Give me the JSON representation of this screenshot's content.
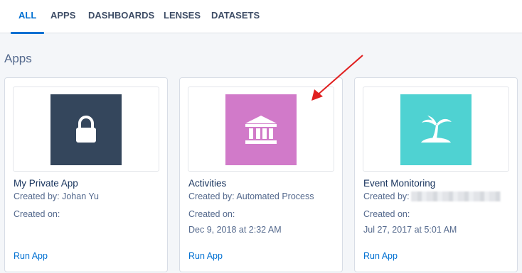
{
  "tabs": [
    {
      "label": "ALL",
      "active": true
    },
    {
      "label": "APPS",
      "active": false
    },
    {
      "label": "DASHBOARDS",
      "active": false
    },
    {
      "label": "LENSES",
      "active": false
    },
    {
      "label": "DATASETS",
      "active": false
    }
  ],
  "section_title": "Apps",
  "cards": [
    {
      "name": "My Private App",
      "created_by": "Created by: Johan Yu",
      "created_on_label": "Created on:",
      "created_on_value": "",
      "run_label": "Run App",
      "icon": "lock-icon",
      "tile_color": "#34465c"
    },
    {
      "name": "Activities",
      "created_by": "Created by: Automated Process",
      "created_on_label": "Created on:",
      "created_on_value": "Dec 9, 2018 at 2:32 AM",
      "run_label": "Run App",
      "icon": "bank-icon",
      "tile_color": "#d17ac9"
    },
    {
      "name": "Event Monitoring",
      "created_by": "Created by:",
      "created_on_label": "Created on:",
      "created_on_value": "Jul 27, 2017 at 5:01 AM",
      "run_label": "Run App",
      "icon": "island-icon",
      "tile_color": "#4fd2d2"
    }
  ],
  "colors": {
    "accent": "#0070d2",
    "annotation_arrow": "#e02020"
  }
}
